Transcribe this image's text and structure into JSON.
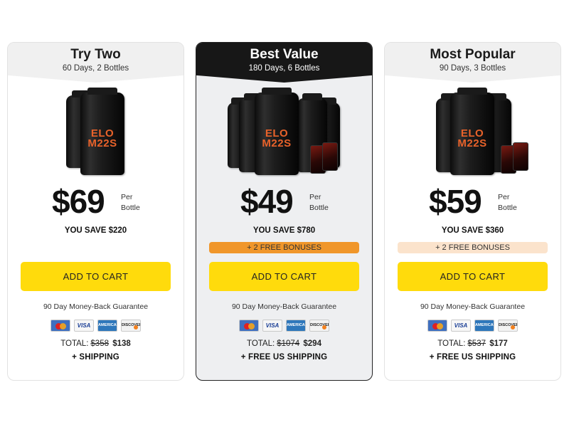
{
  "plans": [
    {
      "title": "Try Two",
      "subtitle": "60 Days, 2 Bottles",
      "product_brand": "ELO M22S",
      "price": "$69",
      "per_line1": "Per",
      "per_line2": "Bottle",
      "savings": "YOU SAVE $220",
      "bonus": "",
      "cta": "ADD TO CART",
      "guarantee": "90 Day Money-Back Guarantee",
      "payment_icons": [
        "mastercard-icon",
        "visa-icon",
        "amex-icon",
        "discover-icon"
      ],
      "total_label": "TOTAL:",
      "total_original": "$358",
      "total_price": "$138",
      "shipping": "+ SHIPPING"
    },
    {
      "title": "Best Value",
      "subtitle": "180 Days, 6 Bottles",
      "product_brand": "ELO M22S",
      "price": "$49",
      "per_line1": "Per",
      "per_line2": "Bottle",
      "savings": "YOU SAVE $780",
      "bonus": "+ 2 FREE BONUSES",
      "cta": "ADD TO CART",
      "guarantee": "90 Day Money-Back Guarantee",
      "payment_icons": [
        "mastercard-icon",
        "visa-icon",
        "amex-icon",
        "discover-icon"
      ],
      "total_label": "TOTAL:",
      "total_original": "$1074",
      "total_price": "$294",
      "shipping": "+ FREE US SHIPPING"
    },
    {
      "title": "Most Popular",
      "subtitle": "90 Days, 3 Bottles",
      "product_brand": "ELO M22S",
      "price": "$59",
      "per_line1": "Per",
      "per_line2": "Bottle",
      "savings": "YOU SAVE $360",
      "bonus": "+ 2 FREE BONUSES",
      "cta": "ADD TO CART",
      "guarantee": "90 Day Money-Back Guarantee",
      "payment_icons": [
        "mastercard-icon",
        "visa-icon",
        "amex-icon",
        "discover-icon"
      ],
      "total_label": "TOTAL:",
      "total_original": "$537",
      "total_price": "$177",
      "shipping": "+ FREE US SHIPPING"
    }
  ],
  "payment_labels": {
    "visa": "VISA",
    "amex": "AMERICAN EXPRESS",
    "discover": "DISCOVER"
  },
  "colors": {
    "cta_yellow": "#ffdb0c",
    "bonus_orange": "#f0962a",
    "bonus_peach": "#fbe3cc",
    "featured_header": "#171717",
    "label_orange": "#e8622a"
  }
}
